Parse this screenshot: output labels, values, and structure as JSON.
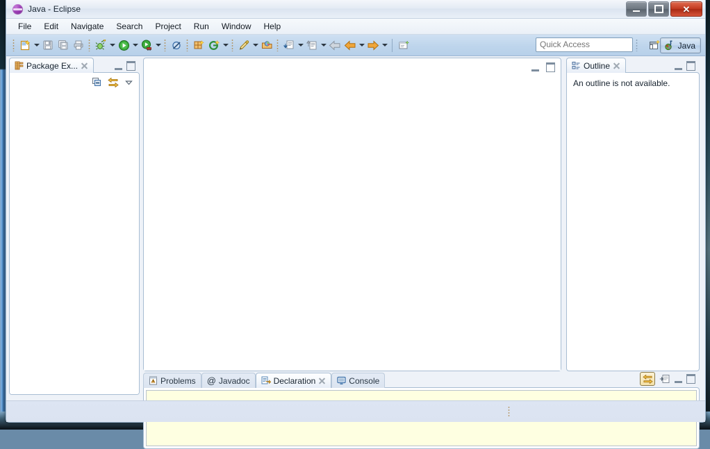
{
  "window": {
    "title": "Java - Eclipse",
    "app_icon": "eclipse-logo-icon",
    "controls": {
      "minimize": "Minimize",
      "restore": "Restore",
      "close": "✕"
    }
  },
  "menubar": {
    "items": [
      {
        "label": "File",
        "name": "menu-file"
      },
      {
        "label": "Edit",
        "name": "menu-edit"
      },
      {
        "label": "Navigate",
        "name": "menu-navigate"
      },
      {
        "label": "Search",
        "name": "menu-search"
      },
      {
        "label": "Project",
        "name": "menu-project"
      },
      {
        "label": "Run",
        "name": "menu-run"
      },
      {
        "label": "Window",
        "name": "menu-window"
      },
      {
        "label": "Help",
        "name": "menu-help"
      }
    ]
  },
  "toolbar": {
    "icons": [
      "new-wizard-icon",
      "save-icon",
      "save-all-icon",
      "print-icon",
      "debug-icon",
      "run-icon",
      "run-external-tools-icon",
      "skip-breakpoints-icon",
      "new-java-package-icon",
      "new-java-class-icon",
      "new-annotation-icon",
      "open-type-icon",
      "next-annotation-icon",
      "previous-annotation-icon",
      "back-icon",
      "back-history-icon",
      "forward-icon",
      "toggle-mark-occurrences-icon"
    ],
    "quick_access": {
      "placeholder": "Quick Access",
      "value": ""
    },
    "open_perspective_label": "Open Perspective",
    "perspective": {
      "label": "Java",
      "icon": "java-perspective-icon",
      "active": true
    }
  },
  "package_explorer": {
    "tab_label": "Package Ex...",
    "tab_icon": "package-explorer-icon",
    "close_label": "Close",
    "buttons": {
      "collapse_all": "Collapse All",
      "link_with_editor": "Link with Editor",
      "view_menu": "View Menu",
      "minimize": "Minimize",
      "maximize": "Maximize"
    },
    "tree_items": []
  },
  "editor_area": {
    "buttons": {
      "restore": "Restore",
      "maximize": "Maximize"
    },
    "content": ""
  },
  "outline": {
    "tab_label": "Outline",
    "tab_icon": "outline-icon",
    "message": "An outline is not available.",
    "buttons": {
      "minimize": "Minimize",
      "maximize": "Maximize"
    }
  },
  "bottom_panel": {
    "tabs": [
      {
        "label": "Problems",
        "icon": "problems-icon",
        "active": false
      },
      {
        "label": "Javadoc",
        "icon": "javadoc-at-icon",
        "active": false
      },
      {
        "label": "Declaration",
        "icon": "declaration-icon",
        "active": true
      },
      {
        "label": "Console",
        "icon": "console-icon",
        "active": false
      }
    ],
    "buttons": {
      "link_with_selection": "Link with Selection",
      "pin_view": "Pin this Declaration View",
      "minimize": "Minimize",
      "maximize": "Maximize"
    },
    "content": ""
  },
  "status_bar": {
    "text": ""
  },
  "colors": {
    "toolbar_bg": "#bed5ec",
    "panel_border": "#a8bdd3",
    "declaration_bg": "#feffe1",
    "perspective_accent": "#7e97b3",
    "close_button": "#c23b21"
  }
}
